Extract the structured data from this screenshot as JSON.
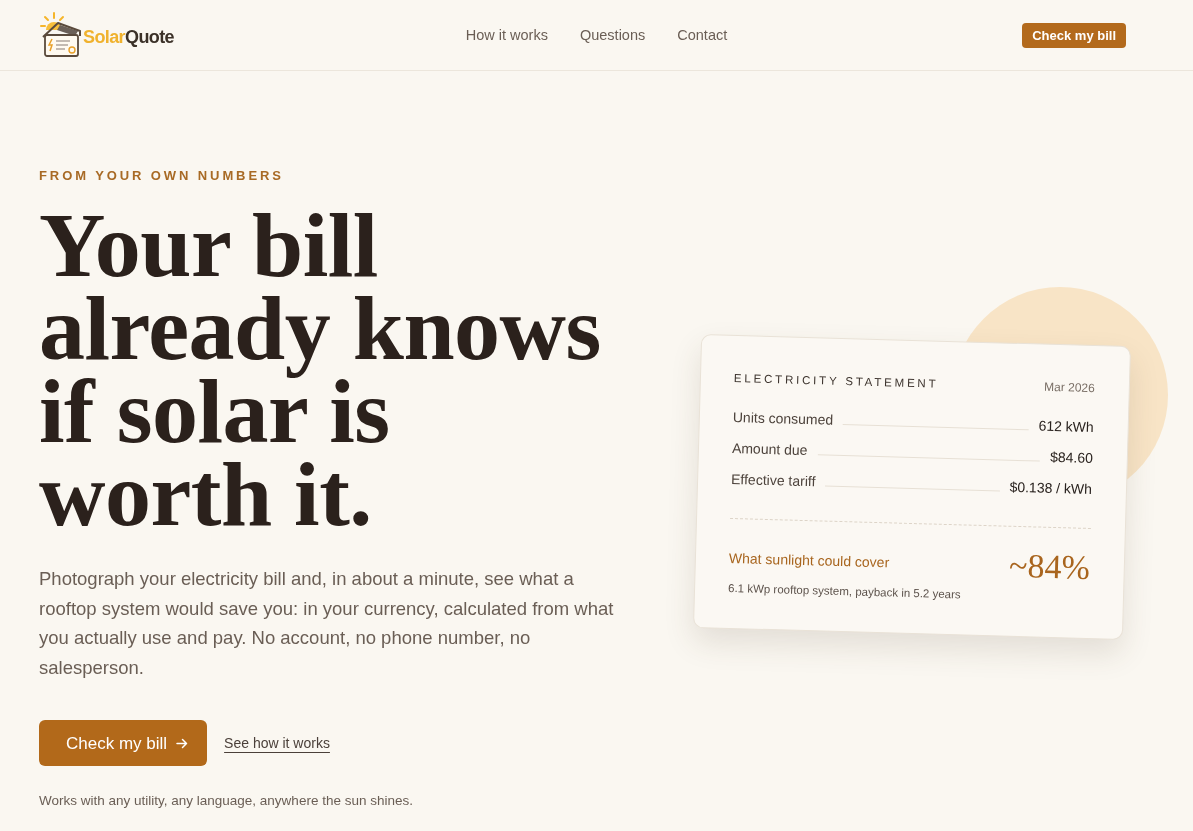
{
  "header": {
    "brand": {
      "parts": [
        "Solar",
        "Quote"
      ]
    },
    "nav": [
      {
        "label": "How it works"
      },
      {
        "label": "Questions"
      },
      {
        "label": "Contact"
      }
    ],
    "cta": "Check my bill"
  },
  "hero": {
    "eyebrow": "FROM YOUR OWN NUMBERS",
    "headline": "Your bill already knows if solar is worth it.",
    "lede": "Photograph your electricity bill and, in about a minute, see what a rooftop system would save you: in your currency, calculated from what you actually use and pay. No account, no phone number, no salesperson.",
    "primary_button": "Check my bill",
    "secondary_link": "See how it works",
    "note": "Works with any utility, any language, anywhere the sun shines."
  },
  "statement": {
    "title": "ELECTRICITY STATEMENT",
    "date": "Mar 2026",
    "rows": [
      {
        "label": "Units consumed",
        "value": "612 kWh"
      },
      {
        "label": "Amount due",
        "value": "$84.60"
      },
      {
        "label": "Effective tariff",
        "value": "$0.138 / kWh"
      }
    ],
    "coverage": {
      "label": "What sunlight could cover",
      "value": "~84%",
      "detail": "6.1 kWp rooftop system, payback in 5.2 years"
    }
  }
}
